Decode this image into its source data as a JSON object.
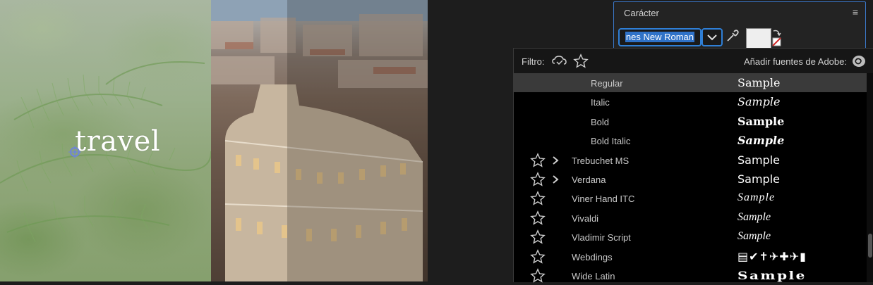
{
  "canvas": {
    "overlay_text": "travel"
  },
  "character_panel": {
    "title": "Carácter",
    "font_field_value": "nes New Roman",
    "fill_color": "#eeeeee"
  },
  "font_list": {
    "filter_label": "Filtro:",
    "adobe_fonts_label": "Añadir fuentes de Adobe:",
    "rows": [
      {
        "name": "Regular",
        "sample": "Sample",
        "kind": "style",
        "selected": true
      },
      {
        "name": "Italic",
        "sample": "Sample",
        "kind": "style"
      },
      {
        "name": "Bold",
        "sample": "Sample",
        "kind": "style"
      },
      {
        "name": "Bold Italic",
        "sample": "Sample",
        "kind": "style"
      },
      {
        "name": "Trebuchet MS",
        "sample": "Sample",
        "kind": "family",
        "expandable": true
      },
      {
        "name": "Verdana",
        "sample": "Sample",
        "kind": "family",
        "expandable": true
      },
      {
        "name": "Viner Hand ITC",
        "sample": "Sample",
        "kind": "family"
      },
      {
        "name": "Vivaldi",
        "sample": "Sample",
        "kind": "family"
      },
      {
        "name": "Vladimir Script",
        "sample": "Sample",
        "kind": "family"
      },
      {
        "name": "Webdings",
        "sample": "▤✔✝✈✚✈▮",
        "kind": "family"
      },
      {
        "name": "Wide Latin",
        "sample": "Sample",
        "kind": "family"
      }
    ]
  },
  "icons": {
    "filter_cloud": "creative-cloud-filter-icon",
    "filter_star": "favorite-filter-icon",
    "adobe": "adobe-cloud-icon",
    "row_star": "star-outline-icon",
    "row_chevron": "chevron-right-icon",
    "eyedropper": "eyedropper-icon",
    "anchor": "anchor-point-icon"
  },
  "colors": {
    "accent": "#2f7fd6",
    "panel_bg": "#232323",
    "list_bg": "#000000",
    "selected_row": "#3a3a3a"
  }
}
